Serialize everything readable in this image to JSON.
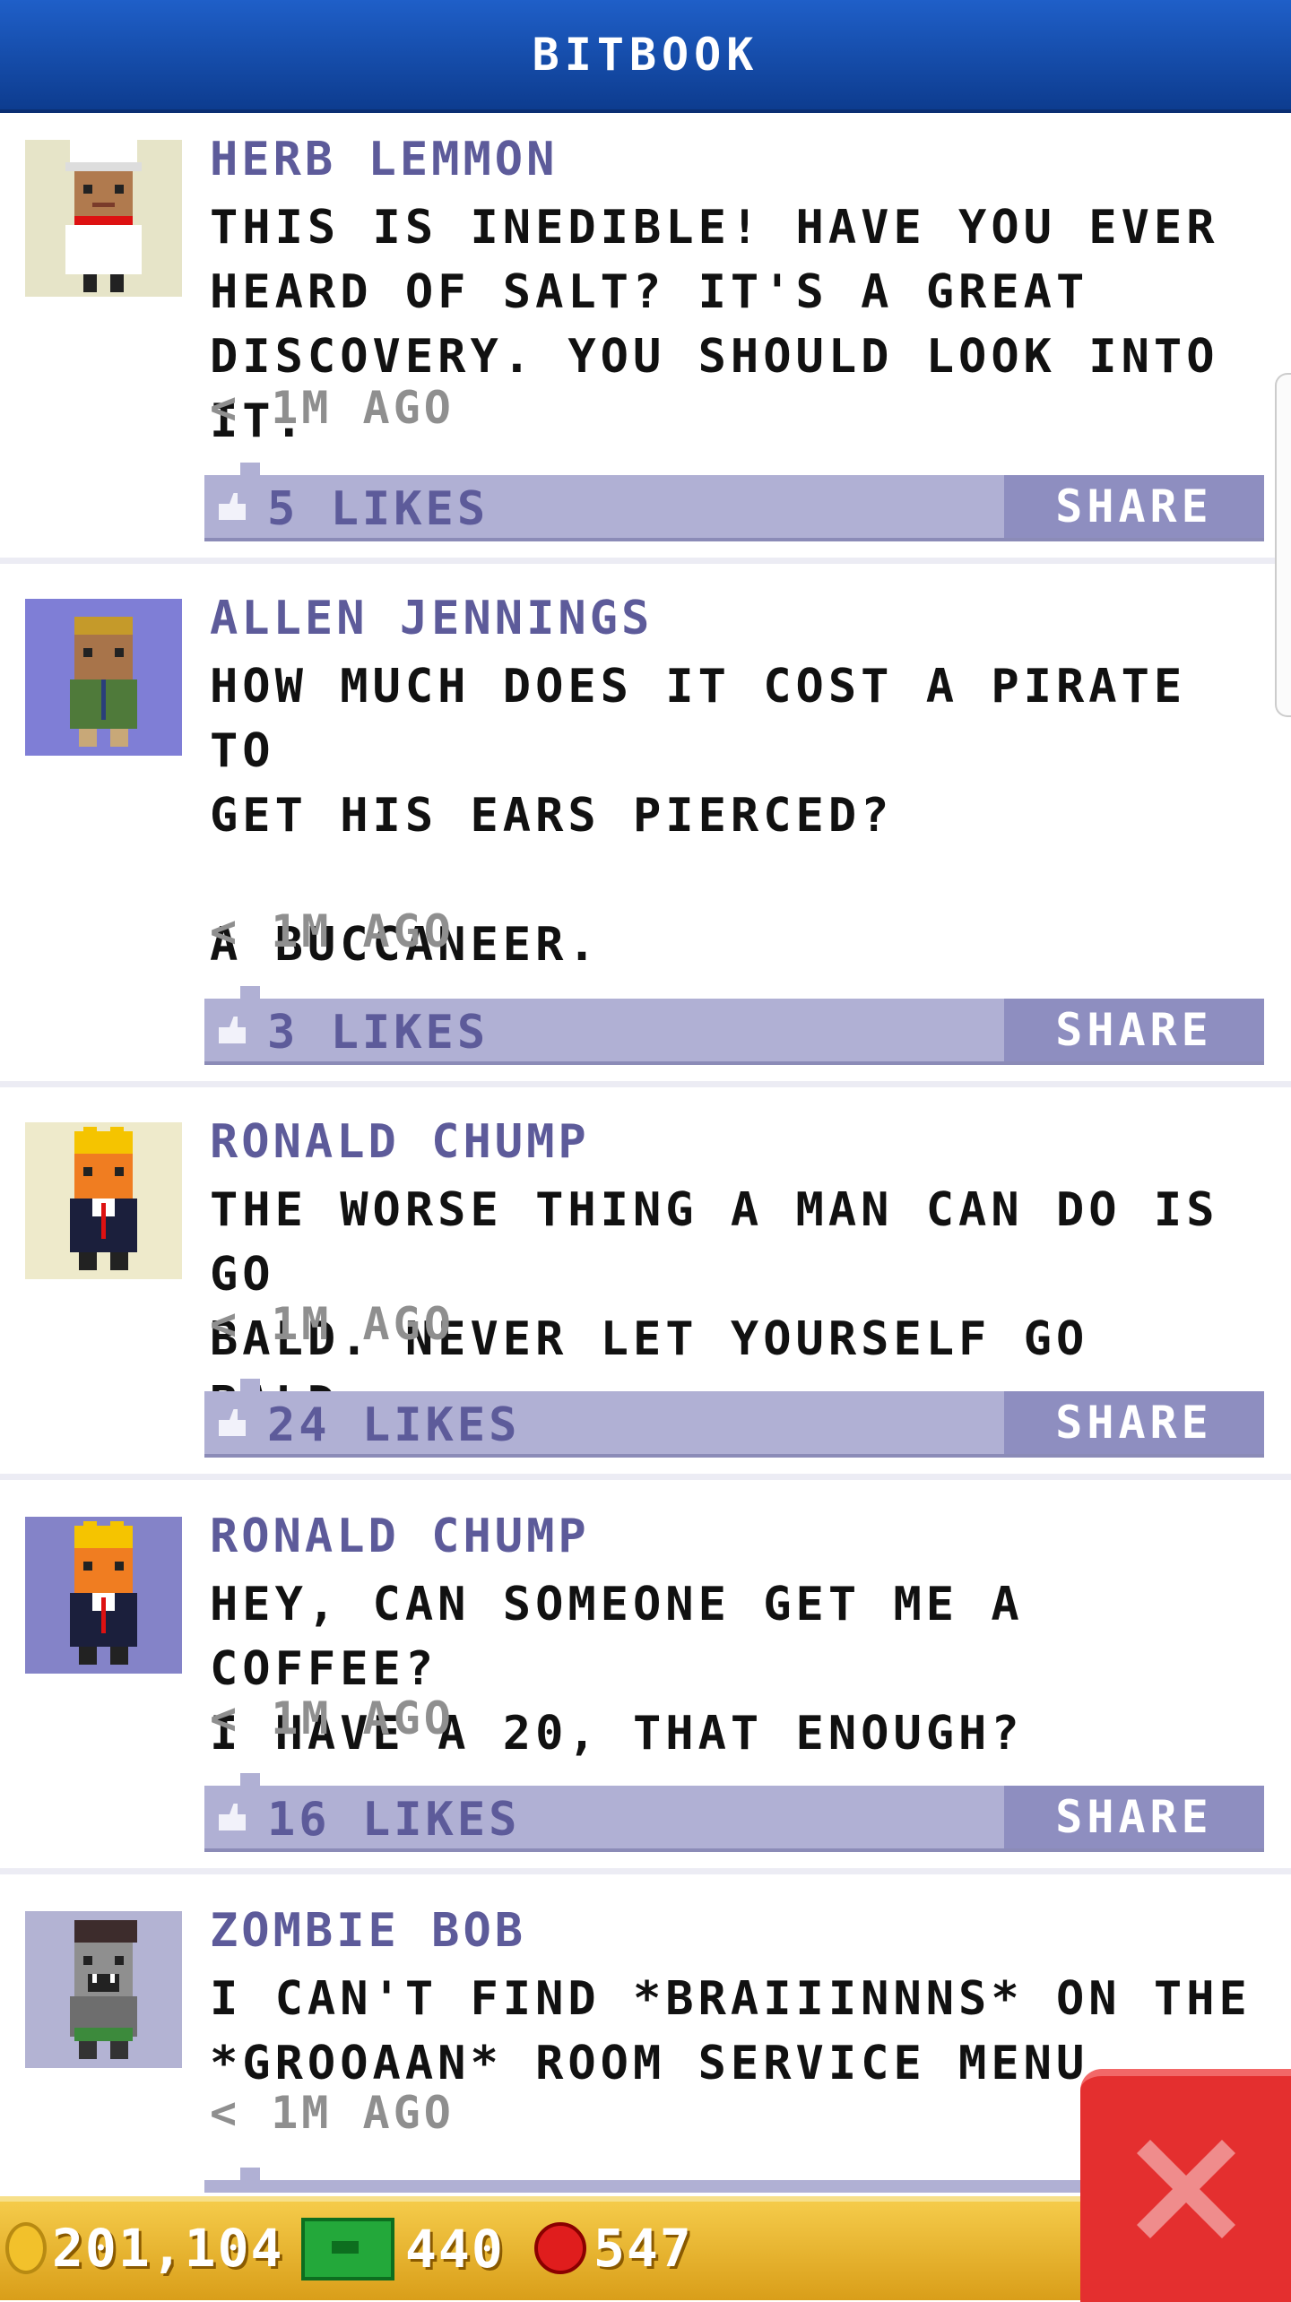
{
  "header": {
    "title": "BITBOOK"
  },
  "posts": [
    {
      "name": "HERB LEMMON",
      "text": "THIS IS INEDIBLE! HAVE YOU EVER\nHEARD OF SALT? IT'S A GREAT\nDISCOVERY. YOU SHOULD LOOK INTO IT.",
      "time": "< 1M AGO",
      "likes": "5 LIKES",
      "share": "SHARE",
      "avatar_bg": "#e6e4c8",
      "avatar_icon": "chef-avatar-icon"
    },
    {
      "name": "ALLEN JENNINGS",
      "text": "HOW MUCH DOES IT COST A PIRATE TO\nGET HIS EARS PIERCED?\n\nA BUCCANEER.",
      "time": "< 1M AGO",
      "likes": "3 LIKES",
      "share": "SHARE",
      "avatar_bg": "#7f7ed6",
      "avatar_icon": "man-avatar-icon"
    },
    {
      "name": "RONALD CHUMP",
      "text": "THE WORSE THING A MAN CAN DO IS GO\nBALD. NEVER LET YOURSELF GO BALD.",
      "time": "< 1M AGO",
      "likes": "24 LIKES",
      "share": "SHARE",
      "avatar_bg": "#eeeacb",
      "avatar_icon": "blond-businessman-avatar-icon"
    },
    {
      "name": "RONALD CHUMP",
      "text": "HEY, CAN SOMEONE GET ME A COFFEE?\nI HAVE A 20, THAT ENOUGH?",
      "time": "< 1M AGO",
      "likes": "16 LIKES",
      "share": "SHARE",
      "avatar_bg": "#8483c8",
      "avatar_icon": "blond-businessman-avatar-icon"
    },
    {
      "name": "ZOMBIE BOB",
      "text": "I CAN'T FIND *BRAIIINNNS* ON THE\n*GROOAAN* ROOM SERVICE MENU",
      "time": "< 1M AGO",
      "avatar_bg": "#b3b3d3",
      "avatar_icon": "zombie-avatar-icon"
    }
  ],
  "currency": {
    "coins": "201,104",
    "bux": "440",
    "tokens": "547"
  }
}
